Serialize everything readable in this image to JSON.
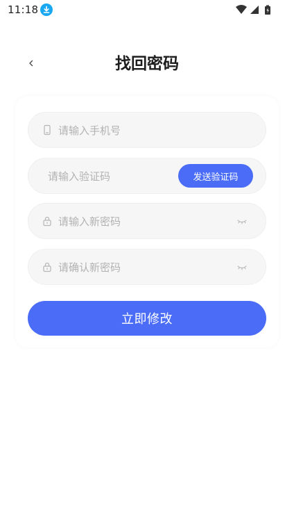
{
  "status_bar": {
    "time": "11:18",
    "icons": [
      "download-icon",
      "wifi-icon",
      "signal-icon",
      "battery-icon"
    ]
  },
  "header": {
    "back_icon": "chevron-left-icon",
    "title": "找回密码"
  },
  "form": {
    "phone": {
      "placeholder": "请输入手机号",
      "icon": "phone-icon"
    },
    "code": {
      "placeholder": "请输入验证码",
      "send_label": "发送验证码"
    },
    "new_password": {
      "placeholder": "请输入新密码",
      "icon": "lock-icon",
      "toggle_icon": "eye-closed-icon"
    },
    "confirm_password": {
      "placeholder": "请确认新密码",
      "icon": "lock-icon",
      "toggle_icon": "eye-closed-icon"
    },
    "submit_label": "立即修改"
  },
  "colors": {
    "accent": "#4a6cf7",
    "field_bg": "#f6f6f6",
    "placeholder": "#b2b2b2",
    "download_badge": "#1aa7f1"
  }
}
